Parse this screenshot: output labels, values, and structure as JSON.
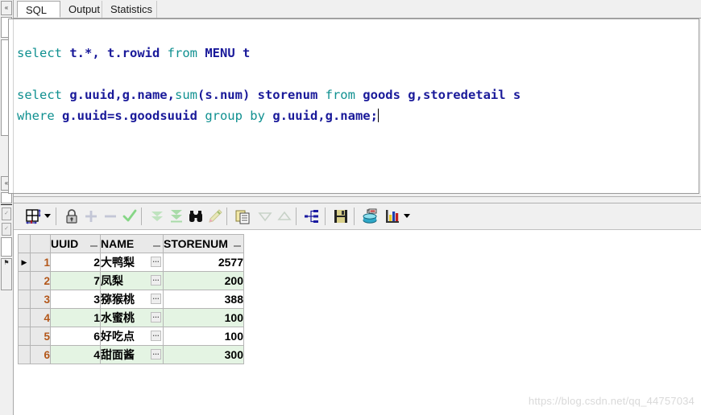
{
  "window": {
    "app": "PL/SQL Developer SQL Window"
  },
  "left_dock": {
    "collapse_top_label": "«",
    "collapse_mid_label": "«",
    "buttons": [
      {
        "name": "dock-collapse-top",
        "label": "«"
      },
      {
        "name": "dock-white-field-top",
        "label": ""
      },
      {
        "name": "dock-collapse-mid",
        "label": "«"
      },
      {
        "name": "dock-tool-a",
        "label": "✓"
      },
      {
        "name": "dock-tool-b",
        "label": "✓"
      },
      {
        "name": "dock-white-field-bottom",
        "label": ""
      },
      {
        "name": "dock-flag",
        "label": "⚑"
      }
    ]
  },
  "tabs": [
    {
      "label": "SQL",
      "active": true
    },
    {
      "label": "Output",
      "active": false
    },
    {
      "label": "Statistics",
      "active": false
    }
  ],
  "editor": {
    "lines": [
      {
        "tokens": [
          {
            "t": "select ",
            "k": "kw"
          },
          {
            "t": "t.*, t.rowid ",
            "k": "id"
          },
          {
            "t": "from ",
            "k": "kw"
          },
          {
            "t": "MENU t",
            "k": "id"
          }
        ]
      },
      {
        "tokens": []
      },
      {
        "tokens": [
          {
            "t": "select ",
            "k": "kw"
          },
          {
            "t": "g.uuid,g.name,",
            "k": "id"
          },
          {
            "t": "sum",
            "k": "kw"
          },
          {
            "t": "(s.num) storenum ",
            "k": "id"
          },
          {
            "t": "from ",
            "k": "kw"
          },
          {
            "t": "goods g,storedetail s",
            "k": "id"
          }
        ]
      },
      {
        "tokens": [
          {
            "t": "where ",
            "k": "kw"
          },
          {
            "t": "g.uuid=s.goodsuuid ",
            "k": "id"
          },
          {
            "t": "group by ",
            "k": "kw"
          },
          {
            "t": "g.uuid,g.name;",
            "k": "id"
          }
        ],
        "caret": true
      }
    ],
    "full_text": "select t.*, t.rowid from MENU t\n\nselect g.uuid,g.name,sum(s.num) storenum from goods g,storedetail s\nwhere g.uuid=s.goodsuuid group by g.uuid,g.name;"
  },
  "toolbar": {
    "items": [
      {
        "name": "grid-layout-icon",
        "enabled": true,
        "glyph": "grid"
      },
      {
        "name": "grid-layout-dropdown-caret",
        "enabled": true,
        "glyph": "caret"
      },
      {
        "name": "lock-icon",
        "enabled": true,
        "glyph": "lock"
      },
      {
        "name": "add-record-icon",
        "enabled": false,
        "glyph": "plus"
      },
      {
        "name": "delete-record-icon",
        "enabled": false,
        "glyph": "minus"
      },
      {
        "name": "post-changes-icon",
        "enabled": true,
        "glyph": "check"
      },
      {
        "name": "fetch-next-page-icon",
        "enabled": false,
        "glyph": "double-down"
      },
      {
        "name": "fetch-last-page-icon",
        "enabled": true,
        "glyph": "down-to-bar"
      },
      {
        "name": "find-icon",
        "enabled": true,
        "glyph": "binoculars"
      },
      {
        "name": "highlight-icon",
        "enabled": false,
        "glyph": "pencil"
      },
      {
        "name": "copy-to-clipboard-icon",
        "enabled": true,
        "glyph": "copy"
      },
      {
        "name": "sort-descending-icon",
        "enabled": false,
        "glyph": "tri-down"
      },
      {
        "name": "sort-ascending-icon",
        "enabled": false,
        "glyph": "tri-up"
      },
      {
        "name": "query-plan-icon",
        "enabled": true,
        "glyph": "tree"
      },
      {
        "name": "save-icon",
        "enabled": true,
        "glyph": "floppy"
      },
      {
        "name": "export-data-icon",
        "enabled": true,
        "glyph": "database-export"
      },
      {
        "name": "chart-icon",
        "enabled": true,
        "glyph": "bar-chart"
      },
      {
        "name": "chart-dropdown-caret",
        "enabled": true,
        "glyph": "caret"
      }
    ]
  },
  "results": {
    "columns": [
      "UUID",
      "NAME",
      "STORENUM"
    ],
    "rows": [
      {
        "num": "1",
        "marker": "▶",
        "uuid": "2",
        "name": "大鸭梨",
        "storenum": "2577"
      },
      {
        "num": "2",
        "marker": "",
        "uuid": "7",
        "name": "凤梨",
        "storenum": "200"
      },
      {
        "num": "3",
        "marker": "",
        "uuid": "3",
        "name": "猕猴桃",
        "storenum": "388"
      },
      {
        "num": "4",
        "marker": "",
        "uuid": "1",
        "name": "水蜜桃",
        "storenum": "100"
      },
      {
        "num": "5",
        "marker": "",
        "uuid": "6",
        "name": "好吃点",
        "storenum": "100"
      },
      {
        "num": "6",
        "marker": "",
        "uuid": "4",
        "name": "甜面酱",
        "storenum": "300"
      }
    ],
    "cell_editor_label": "…"
  },
  "watermark": {
    "text": "https://blog.csdn.net/qq_44757034"
  },
  "colors": {
    "keyword": "#0f9090",
    "identifier": "#1a1a9a",
    "row_alt": "#e4f4e3",
    "rownum": "#b3571a",
    "chrome": "#f0f0f0"
  }
}
